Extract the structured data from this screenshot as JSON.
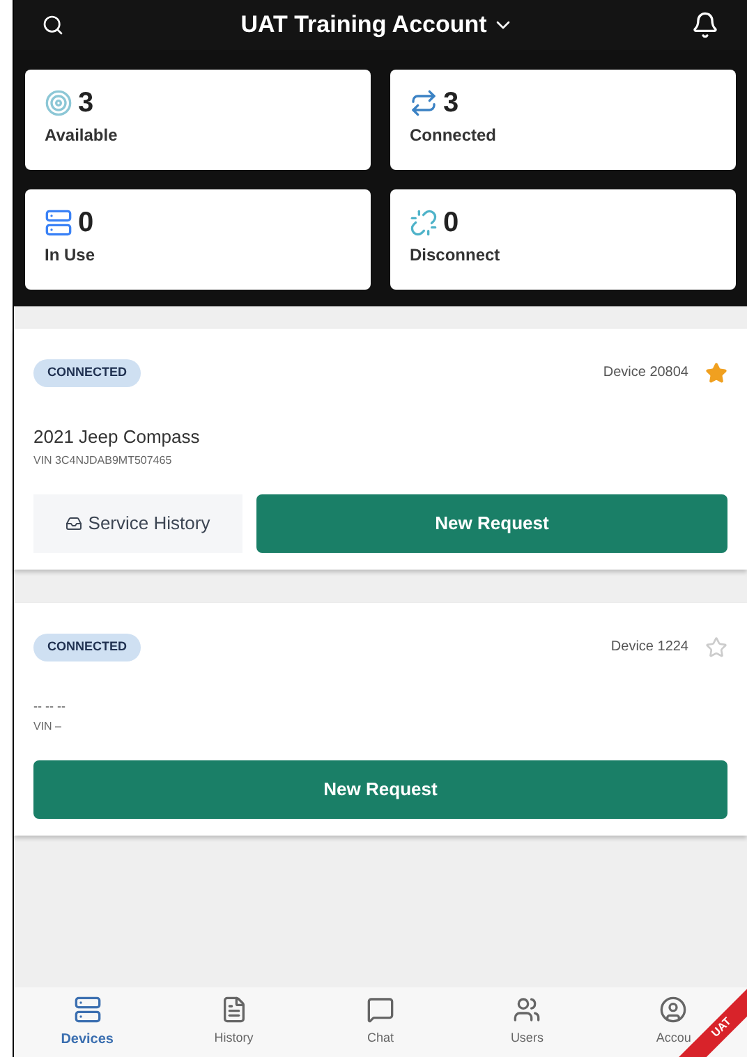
{
  "header": {
    "title": "UAT Training Account"
  },
  "stats": [
    {
      "kind": "available",
      "count": "3",
      "label": "Available"
    },
    {
      "kind": "connected",
      "count": "3",
      "label": "Connected"
    },
    {
      "kind": "in_use",
      "count": "0",
      "label": "In Use"
    },
    {
      "kind": "disconnect",
      "count": "0",
      "label": "Disconnect"
    }
  ],
  "devices": [
    {
      "status": "CONNECTED",
      "device": "Device 20804",
      "favorite": true,
      "vehicle": "2021 Jeep Compass",
      "vin": "VIN 3C4NJDAB9MT507465",
      "service_history": "Service History",
      "request": "New Request"
    },
    {
      "status": "CONNECTED",
      "device": "Device 1224",
      "favorite": false,
      "vehicle": "-- -- --",
      "vin": "VIN –",
      "request": "New Request"
    }
  ],
  "nav": [
    {
      "kind": "devices",
      "label": "Devices",
      "selected": true
    },
    {
      "kind": "history",
      "label": "History",
      "selected": false
    },
    {
      "kind": "chat",
      "label": "Chat",
      "selected": false
    },
    {
      "kind": "users",
      "label": "Users",
      "selected": false
    },
    {
      "kind": "account",
      "label": "Accou",
      "selected": false
    }
  ],
  "ribbon": "UAT"
}
